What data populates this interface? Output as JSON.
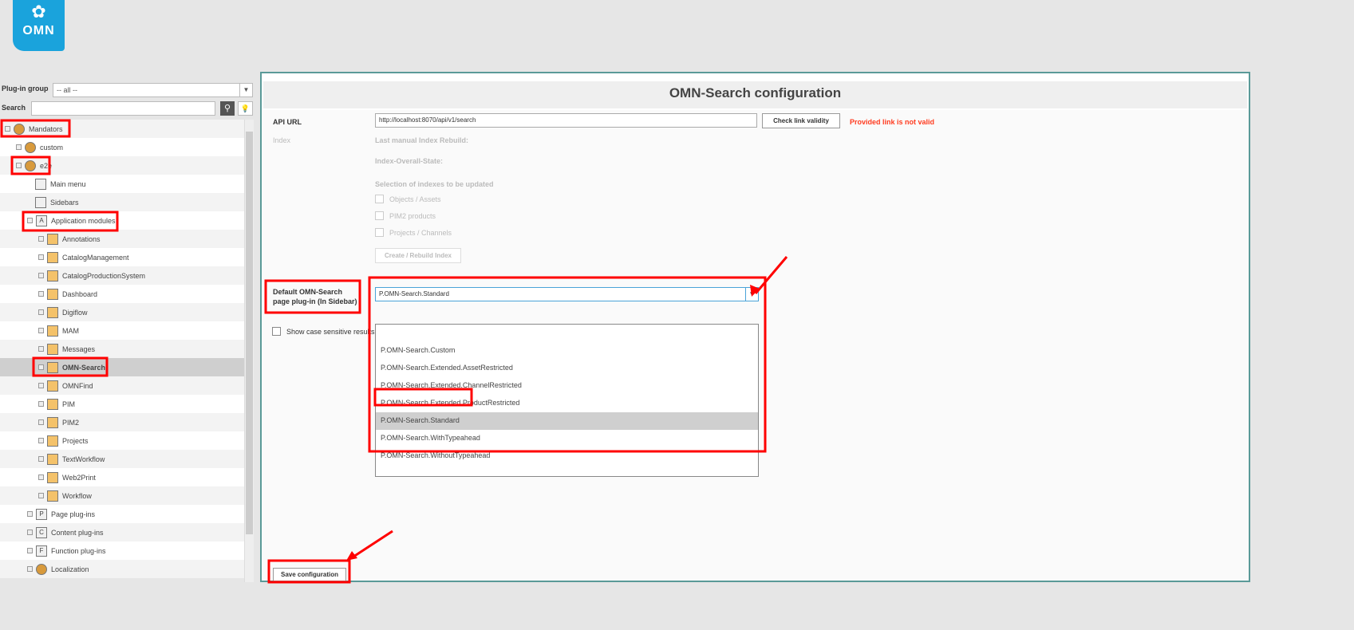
{
  "logo": {
    "text": "OMN"
  },
  "left": {
    "plugin_group_label": "Plug-in group",
    "plugin_group_value": "-- all --",
    "search_label": "Search",
    "search_placeholder": "",
    "tree": [
      {
        "label": "Mandators",
        "level": 0,
        "icon": "group-icon"
      },
      {
        "label": "custom",
        "level": 1,
        "icon": "mandator-icon"
      },
      {
        "label": "e2e",
        "level": 1,
        "icon": "mandator-icon"
      },
      {
        "label": "Main menu",
        "level": 3,
        "icon": "menu-icon"
      },
      {
        "label": "Sidebars",
        "level": 3,
        "icon": "sidebar-icon"
      },
      {
        "label": "Application modules",
        "level": 2,
        "icon": "A"
      },
      {
        "label": "Annotations",
        "level": 3,
        "icon": "plugin-icon"
      },
      {
        "label": "CatalogManagement",
        "level": 3,
        "icon": "plugin-icon"
      },
      {
        "label": "CatalogProductionSystem",
        "level": 3,
        "icon": "plugin-icon"
      },
      {
        "label": "Dashboard",
        "level": 3,
        "icon": "plugin-icon"
      },
      {
        "label": "Digiflow",
        "level": 3,
        "icon": "plugin-icon"
      },
      {
        "label": "MAM",
        "level": 3,
        "icon": "plugin-icon"
      },
      {
        "label": "Messages",
        "level": 3,
        "icon": "plugin-icon"
      },
      {
        "label": "OMN-Search",
        "level": 3,
        "icon": "plugin-icon",
        "selected": true
      },
      {
        "label": "OMNFind",
        "level": 3,
        "icon": "plugin-icon"
      },
      {
        "label": "PIM",
        "level": 3,
        "icon": "plugin-icon"
      },
      {
        "label": "PIM2",
        "level": 3,
        "icon": "plugin-icon"
      },
      {
        "label": "Projects",
        "level": 3,
        "icon": "plugin-icon"
      },
      {
        "label": "TextWorkflow",
        "level": 3,
        "icon": "plugin-icon"
      },
      {
        "label": "Web2Print",
        "level": 3,
        "icon": "plugin-icon"
      },
      {
        "label": "Workflow",
        "level": 3,
        "icon": "plugin-icon"
      },
      {
        "label": "Page plug-ins",
        "level": 2,
        "icon": "P"
      },
      {
        "label": "Content plug-ins",
        "level": 2,
        "icon": "C"
      },
      {
        "label": "Function plug-ins",
        "level": 2,
        "icon": "F"
      },
      {
        "label": "Localization",
        "level": 2,
        "icon": "mandator-icon"
      }
    ]
  },
  "main": {
    "title": "OMN-Search configuration",
    "api_url_label": "API URL",
    "api_url_value": "http://localhost:8070/api/v1/search",
    "check_button": "Check link validity",
    "error": "Provided link is not valid",
    "error_color": "#ff3b1f",
    "index_label": "Index",
    "last_rebuild": "Last manual Index Rebuild:",
    "overall_state": "Index-Overall-State:",
    "selection_label": "Selection of indexes to be updated",
    "indexes": [
      "Objects / Assets",
      "PIM2 products",
      "Projects / Channels"
    ],
    "rebuild_button": "Create / Rebuild Index",
    "default_label_1": "Default OMN-Search",
    "default_label_2": "page plug-in (In Sidebar)",
    "default_value": "P.OMN-Search.Standard",
    "options": [
      "",
      "P.OMN-Search.Custom",
      "P.OMN-Search.Extended.AssetRestricted",
      "P.OMN-Search.Extended.ChannelRestricted",
      "P.OMN-Search.Extended.ProductRestricted",
      "P.OMN-Search.Standard",
      "P.OMN-Search.WithTypeahead",
      "P.OMN-Search.WithoutTypeahead"
    ],
    "selected_option": "P.OMN-Search.Standard",
    "case_sensitive_label": "Show case sensitive results",
    "save_button": "Save configuration"
  }
}
